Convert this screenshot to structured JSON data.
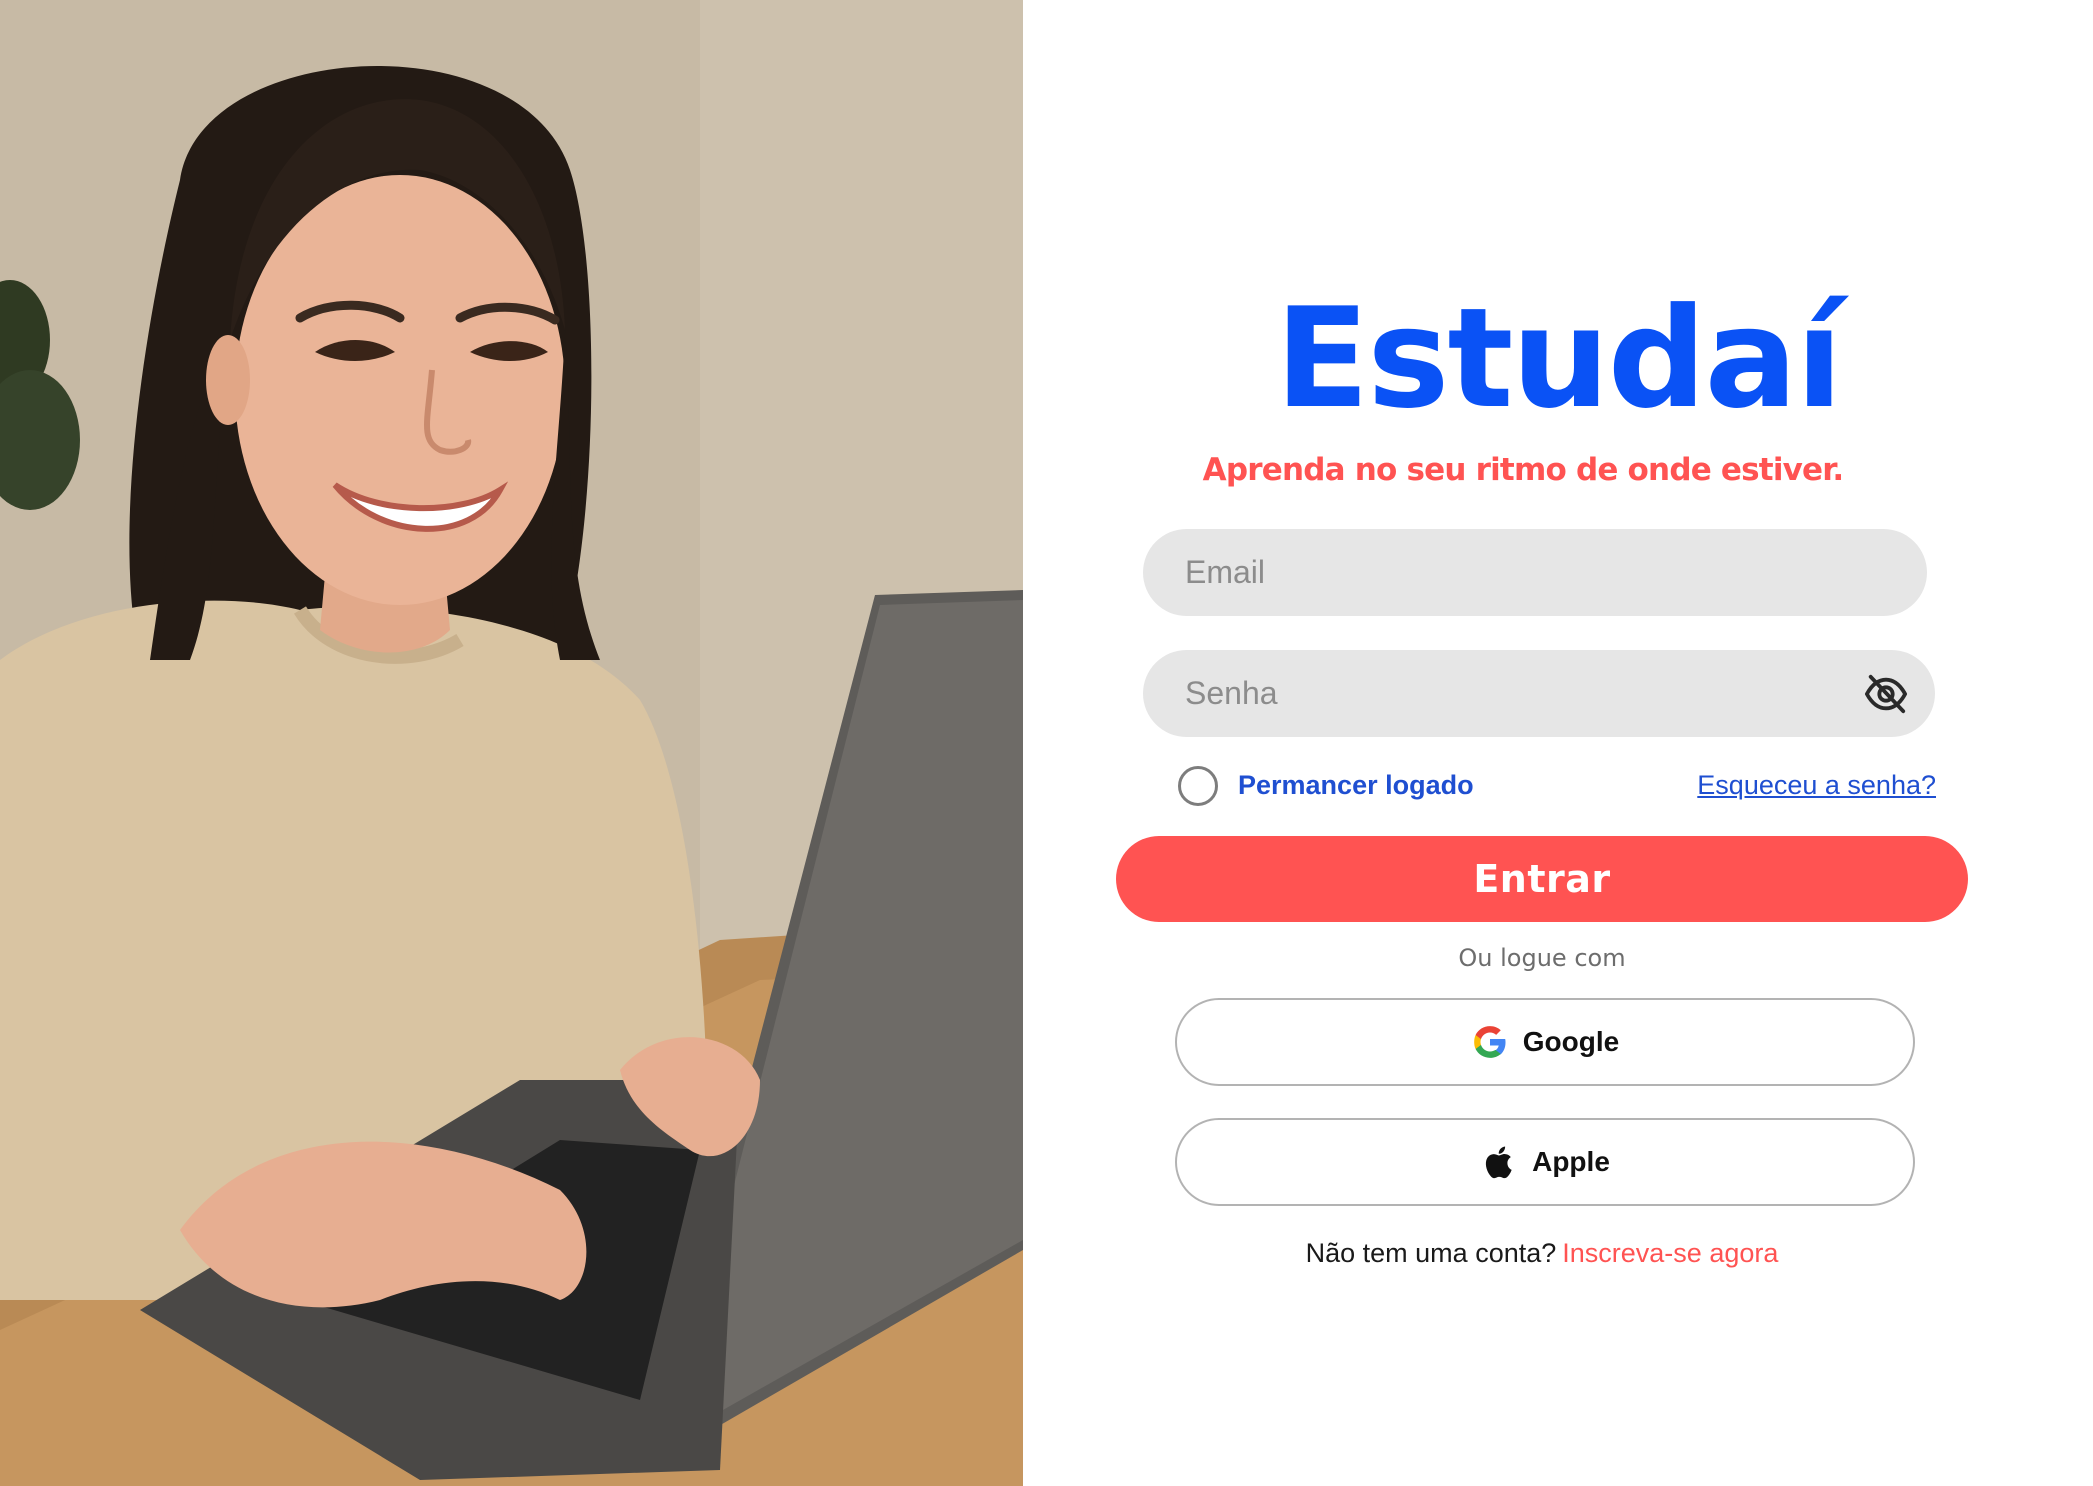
{
  "photo": {
    "description_icon": "woman-laptop-photo"
  },
  "brand": {
    "name": "Estudaí",
    "tagline": "Aprenda no seu ritmo de onde estiver."
  },
  "form": {
    "email_placeholder": "Email",
    "password_placeholder": "Senha",
    "password_toggle_icon": "eye-off-icon",
    "remember_label": "Permancer logado",
    "forgot_label": "Esqueceu a senha?",
    "submit_label": "Entrar"
  },
  "social": {
    "divider_label": "Ou logue com",
    "google_label": "Google",
    "google_icon": "google-icon",
    "apple_label": "Apple",
    "apple_icon": "apple-icon"
  },
  "signup": {
    "prompt": "Não tem uma conta?",
    "link_label": "Inscreva-se agora"
  },
  "colors": {
    "brand_blue": "#0a52f5",
    "accent_red": "#ff5352",
    "link_blue": "#1f4fd1",
    "field_gray": "#e6e6e6"
  }
}
